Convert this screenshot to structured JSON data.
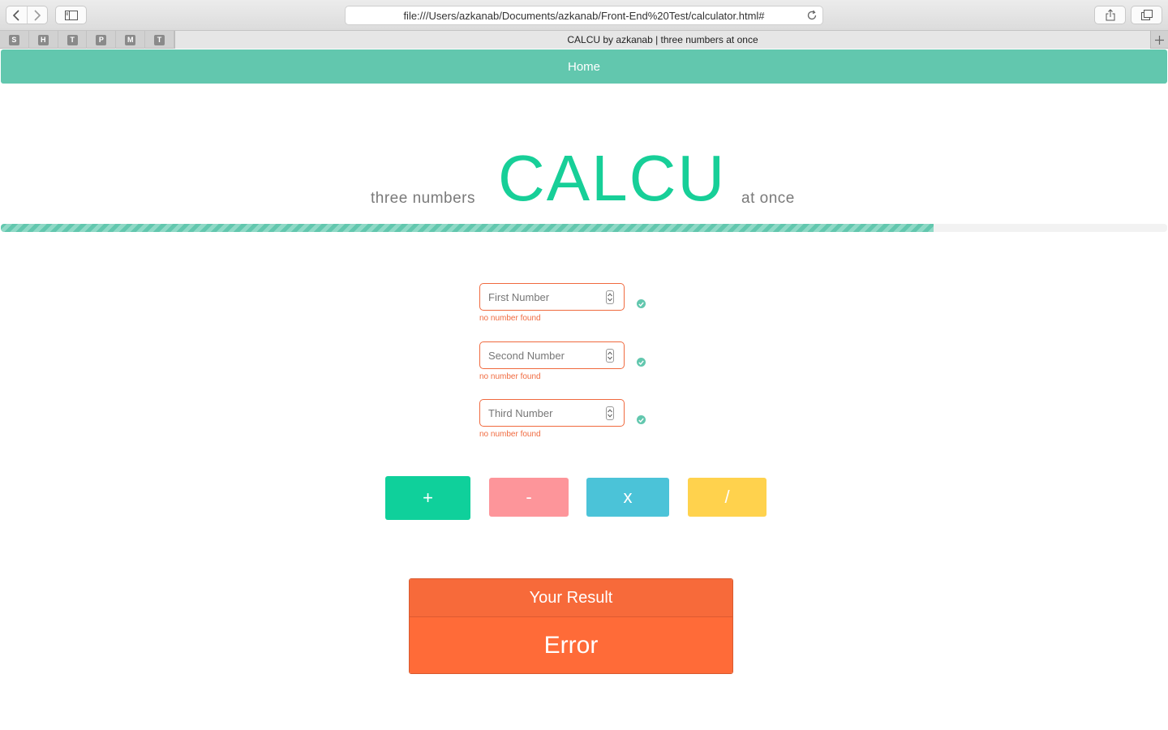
{
  "browser": {
    "url": "file:///Users/azkanab/Documents/azkanab/Front-End%20Test/calculator.html#",
    "tab_title": "CALCU by azkanab | three numbers at once",
    "bookmarks": [
      "S",
      "H",
      "T",
      "P",
      "M",
      "T"
    ]
  },
  "navbar": {
    "home": "Home"
  },
  "hero": {
    "tagline_left": "three numbers",
    "brand": "CALCU",
    "tagline_right": "at once"
  },
  "progress": {
    "fraction": 0.8
  },
  "form": {
    "first": {
      "placeholder": "First Number",
      "value": "",
      "error": "no number found"
    },
    "second": {
      "placeholder": "Second Number",
      "value": "",
      "error": "no number found"
    },
    "third": {
      "placeholder": "Third Number",
      "value": "",
      "error": "no number found"
    }
  },
  "operations": {
    "add": "+",
    "subtract": "-",
    "multiply": "x",
    "divide": "/"
  },
  "result": {
    "label": "Your Result",
    "value": "Error"
  },
  "colors": {
    "accent": "#62c7ae",
    "brand": "#17cf98",
    "error": "#f06a3f",
    "add": "#0fd09b",
    "subtract": "#fd959a",
    "multiply": "#4bc3d8",
    "divide": "#ffd24d",
    "result": "#ff6b38"
  }
}
